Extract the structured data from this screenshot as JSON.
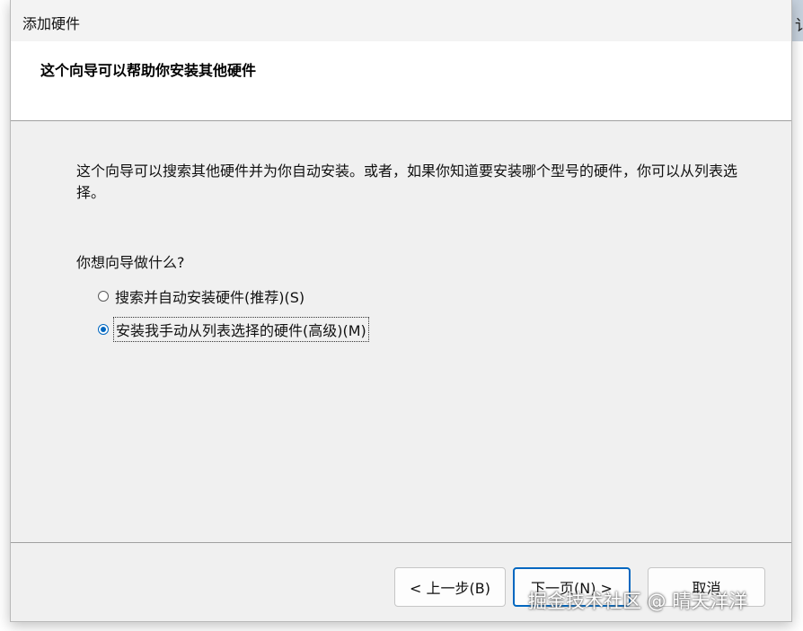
{
  "background_window": {
    "title_fragment": "讠"
  },
  "window": {
    "title": "添加硬件"
  },
  "header": {
    "heading": "这个向导可以帮助你安装其他硬件"
  },
  "body": {
    "description": "这个向导可以搜索其他硬件并为你自动安装。或者，如果你知道要安装哪个型号的硬件，你可以从列表选择。",
    "question": "你想向导做什么?",
    "options": [
      {
        "label": "搜索并自动安装硬件(推荐)(S)",
        "checked": false
      },
      {
        "label": "安装我手动从列表选择的硬件(高级)(M)",
        "checked": true
      }
    ]
  },
  "buttons": {
    "back": "< 上一步(B)",
    "next": "下一页(N) >",
    "cancel": "取消"
  },
  "watermark": "掘金技术社区 @ 晴天洋洋",
  "colors": {
    "accent": "#0067c0",
    "dialog_bg": "#f0f0f0",
    "header_bg": "#ffffff"
  }
}
